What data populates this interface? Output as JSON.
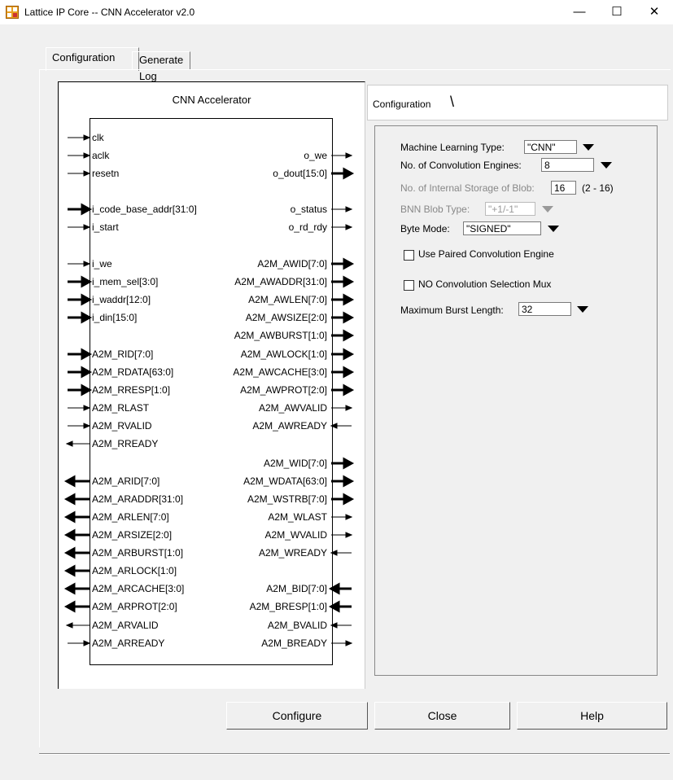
{
  "window": {
    "title": "Lattice IP Core -- CNN Accelerator v2.0",
    "minimize": "—",
    "maximize": "☐",
    "close": "✕"
  },
  "tabs": [
    "Configuration",
    "Generate Log"
  ],
  "diagram": {
    "title": "CNN Accelerator",
    "left_pins": [
      "clk",
      "aclk",
      "resetn",
      "i_code_base_addr[31:0]",
      "i_start",
      "i_we",
      "i_mem_sel[3:0]",
      "i_waddr[12:0]",
      "i_din[15:0]",
      "A2M_RID[7:0]",
      "A2M_RDATA[63:0]",
      "A2M_RRESP[1:0]",
      "A2M_RLAST",
      "A2M_RVALID",
      "A2M_RREADY",
      "A2M_ARID[7:0]",
      "A2M_ARADDR[31:0]",
      "A2M_ARLEN[7:0]",
      "A2M_ARSIZE[2:0]",
      "A2M_ARBURST[1:0]",
      "A2M_ARLOCK[1:0]",
      "A2M_ARCACHE[3:0]",
      "A2M_ARPROT[2:0]",
      "A2M_ARVALID",
      "A2M_ARREADY"
    ],
    "right_pins": [
      "o_we",
      "o_dout[15:0]",
      "o_status",
      "o_rd_rdy",
      "A2M_AWID[7:0]",
      "A2M_AWADDR[31:0]",
      "A2M_AWLEN[7:0]",
      "A2M_AWSIZE[2:0]",
      "A2M_AWBURST[1:0]",
      "A2M_AWLOCK[1:0]",
      "A2M_AWCACHE[3:0]",
      "A2M_AWPROT[2:0]",
      "A2M_AWVALID",
      "A2M_AWREADY",
      "A2M_WID[7:0]",
      "A2M_WDATA[63:0]",
      "A2M_WSTRB[7:0]",
      "A2M_WLAST",
      "A2M_WVALID",
      "A2M_WREADY",
      "A2M_BID[7:0]",
      "A2M_BRESP[1:0]",
      "A2M_BVALID",
      "A2M_BREADY"
    ]
  },
  "settings": {
    "tab_label": "Configuration",
    "ml_type_label": "Machine Learning Type:",
    "ml_type_value": "\"CNN\"",
    "conv_engines_label": "No. of Convolution Engines:",
    "conv_engines_value": "8",
    "blob_storage_label": "No. of Internal Storage of Blob:",
    "blob_storage_value": "16",
    "blob_storage_range": "(2 - 16)",
    "bnn_blob_label": "BNN Blob Type:",
    "bnn_blob_value": "\"+1/-1\"",
    "byte_mode_label": "Byte Mode:",
    "byte_mode_value": "\"SIGNED\"",
    "paired_conv_label": "Use Paired Convolution Engine",
    "paired_conv_checked": false,
    "no_conv_mux_label": "NO Convolution Selection Mux",
    "no_conv_mux_checked": false,
    "burst_length_label": "Maximum Burst Length:",
    "burst_length_value": "32"
  },
  "buttons": {
    "configure": "Configure",
    "close": "Close",
    "help": "Help"
  }
}
